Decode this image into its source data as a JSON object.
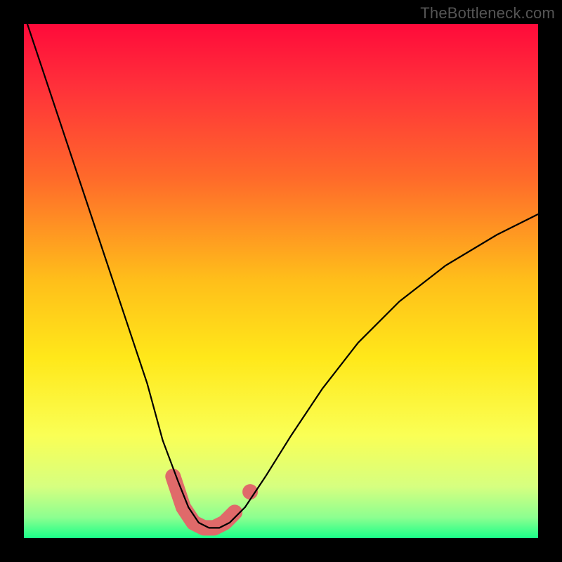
{
  "watermark": "TheBottleneck.com",
  "chart_data": {
    "type": "line",
    "title": "",
    "xlabel": "",
    "ylabel": "",
    "xlim": [
      0,
      100
    ],
    "ylim": [
      0,
      100
    ],
    "background_gradient": {
      "stops": [
        {
          "offset": 0.0,
          "color": "#ff0a3a"
        },
        {
          "offset": 0.12,
          "color": "#ff303a"
        },
        {
          "offset": 0.3,
          "color": "#ff6a2a"
        },
        {
          "offset": 0.5,
          "color": "#ffbf1a"
        },
        {
          "offset": 0.65,
          "color": "#ffe81a"
        },
        {
          "offset": 0.8,
          "color": "#faff55"
        },
        {
          "offset": 0.9,
          "color": "#d6ff80"
        },
        {
          "offset": 0.96,
          "color": "#8cff90"
        },
        {
          "offset": 1.0,
          "color": "#1aff88"
        }
      ]
    },
    "series": [
      {
        "name": "bottleneck-curve",
        "x": [
          0,
          4,
          8,
          12,
          16,
          20,
          24,
          27,
          30,
          32,
          34,
          36,
          38,
          40,
          43,
          47,
          52,
          58,
          65,
          73,
          82,
          92,
          100
        ],
        "values": [
          102,
          90,
          78,
          66,
          54,
          42,
          30,
          19,
          11,
          6,
          3,
          2,
          2,
          3,
          6,
          12,
          20,
          29,
          38,
          46,
          53,
          59,
          63
        ]
      }
    ],
    "highlight_segment": {
      "name": "valley-highlight",
      "color": "#e06a6a",
      "points": [
        {
          "x": 29,
          "y": 12
        },
        {
          "x": 31,
          "y": 6
        },
        {
          "x": 33,
          "y": 3
        },
        {
          "x": 35,
          "y": 2
        },
        {
          "x": 37,
          "y": 2
        },
        {
          "x": 39,
          "y": 3
        },
        {
          "x": 41,
          "y": 5
        }
      ],
      "extra_dot": {
        "x": 44,
        "y": 9
      }
    }
  }
}
